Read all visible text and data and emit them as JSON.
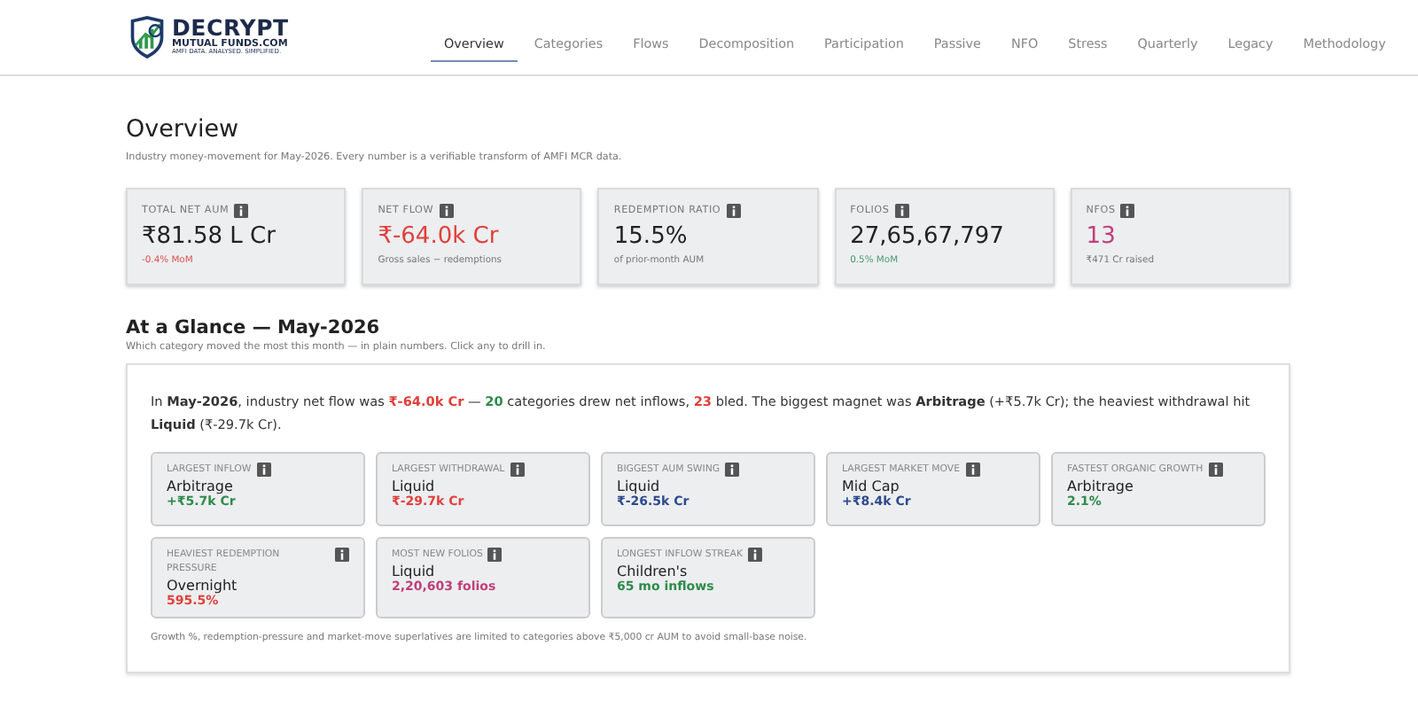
{
  "brand": {
    "name": "DECRYPT",
    "domain": "MUTUAL FUNDS.COM",
    "tagline": "AMFI DATA. ANALYSED. SIMPLIFIED."
  },
  "nav": [
    {
      "label": "Overview",
      "selected": true
    },
    {
      "label": "Categories",
      "selected": false
    },
    {
      "label": "Flows",
      "selected": false
    },
    {
      "label": "Decomposition",
      "selected": false
    },
    {
      "label": "Participation",
      "selected": false
    },
    {
      "label": "Passive",
      "selected": false
    },
    {
      "label": "NFO",
      "selected": false
    },
    {
      "label": "Stress",
      "selected": false
    },
    {
      "label": "Quarterly",
      "selected": false
    },
    {
      "label": "Legacy",
      "selected": false
    },
    {
      "label": "Methodology",
      "selected": false
    }
  ],
  "overview": {
    "title": "Overview",
    "subtitle": "Industry money-movement for May-2026. Every number is a verifiable transform of AMFI MCR data.",
    "kpis": [
      {
        "label": "TOTAL NET AUM",
        "value": {
          "text": "₹81.58 L Cr",
          "color": "#222222"
        },
        "note": {
          "text": "-0.4% MoM",
          "color": "#e05050"
        }
      },
      {
        "label": "NET FLOW",
        "value": {
          "text": "₹-64.0k Cr",
          "color": "#e0403a"
        },
        "note": {
          "text": "Gross sales − redemptions",
          "color": "#777777"
        }
      },
      {
        "label": "REDEMPTION RATIO",
        "value": {
          "text": "15.5%",
          "color": "#222222"
        },
        "note": {
          "text": "of prior-month AUM",
          "color": "#777777"
        }
      },
      {
        "label": "FOLIOS",
        "value": {
          "text": "27,65,67,797",
          "color": "#222222"
        },
        "note": {
          "text": "0.5% MoM",
          "color": "#4a9a6a"
        }
      },
      {
        "label": "NFOS",
        "value": {
          "text": "13",
          "color": "#c0407a"
        },
        "note": {
          "text": "₹471 Cr raised",
          "color": "#777777"
        }
      }
    ]
  },
  "glance": {
    "title": "At a Glance — May-2026",
    "subtitle": "Which category moved the most this month — in plain numbers. Click any to drill in.",
    "summary": [
      {
        "kind": "plain",
        "text": "In "
      },
      {
        "kind": "bold",
        "text": "May-2026"
      },
      {
        "kind": "plain",
        "text": ", industry net flow was "
      },
      {
        "kind": "negative",
        "text": "₹-64.0k Cr"
      },
      {
        "kind": "plain",
        "text": " — "
      },
      {
        "kind": "positive",
        "text": "20"
      },
      {
        "kind": "plain",
        "text": " categories drew net inflows, "
      },
      {
        "kind": "negative",
        "text": "23"
      },
      {
        "kind": "plain",
        "text": " bled. The biggest magnet was "
      },
      {
        "kind": "bold",
        "text": "Arbitrage"
      },
      {
        "kind": "plain",
        "text": " (+₹5.7k Cr); the heaviest withdrawal hit "
      },
      {
        "kind": "bold",
        "text": "Liquid"
      },
      {
        "kind": "plain",
        "text": " (₹-29.7k Cr)."
      }
    ],
    "cards": [
      {
        "label": "LARGEST INFLOW",
        "name": "Arbitrage",
        "value": "+₹5.7k Cr",
        "color": "#2e8b4a"
      },
      {
        "label": "LARGEST WITHDRAWAL",
        "name": "Liquid",
        "value": "₹-29.7k Cr",
        "color": "#e0403a"
      },
      {
        "label": "BIGGEST AUM SWING",
        "name": "Liquid",
        "value": "₹-26.5k Cr",
        "color": "#2c4a8c"
      },
      {
        "label": "LARGEST MARKET MOVE",
        "name": "Mid Cap",
        "value": "+₹8.4k Cr",
        "color": "#2c4a8c"
      },
      {
        "label": "FASTEST ORGANIC GROWTH",
        "name": "Arbitrage",
        "value": "2.1%",
        "color": "#2e8b4a"
      },
      {
        "label": "HEAVIEST REDEMPTION PRESSURE",
        "name": "Overnight",
        "value": "595.5%",
        "color": "#e0403a"
      },
      {
        "label": "MOST NEW FOLIOS",
        "name": "Liquid",
        "value": "2,20,603 folios",
        "color": "#c0407a"
      },
      {
        "label": "LONGEST INFLOW STREAK",
        "name": "Children's",
        "value": "65 mo inflows",
        "color": "#2e8b4a"
      }
    ],
    "footnote": "Growth %, redemption-pressure and market-move superlatives are limited to categories above ₹5,000 cr AUM to avoid small-base noise."
  }
}
